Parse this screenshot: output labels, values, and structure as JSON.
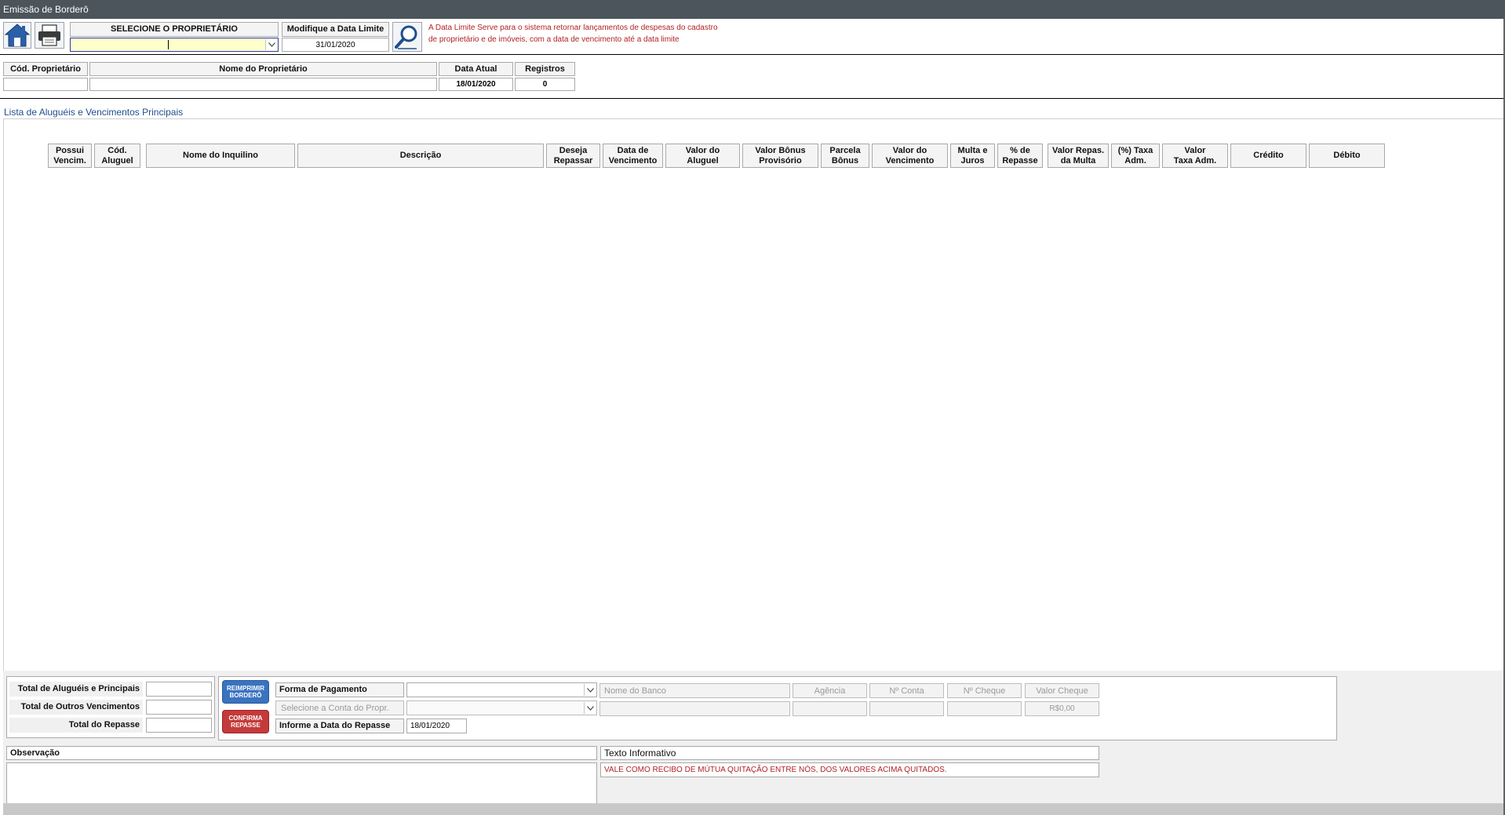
{
  "window": {
    "title": "Emissão de Borderô"
  },
  "toolbar": {
    "owner_header": "SELECIONE O PROPRIETÁRIO",
    "owner_value": "",
    "date_limit_header": "Modifique a Data Limite",
    "date_limit_value": "31/01/2020",
    "info_line1": "A Data Limite Serve para o sistema retornar lançamentos de despesas do cadastro",
    "info_line2": "de proprietário e de imóveis, com a data de vencimento até a data limite"
  },
  "owner_info": {
    "headers": [
      "Cód. Proprietário",
      "Nome do Proprietário",
      "Data Atual",
      "Registros"
    ],
    "values": [
      "",
      "",
      "18/01/2020",
      "0"
    ]
  },
  "list": {
    "title": "Lista de Aluguéis e Vencimentos Principais",
    "columns": [
      [
        "Possui",
        "Vencim."
      ],
      [
        "Cód.",
        "Aluguel"
      ],
      [
        "Nome do Inquilino"
      ],
      [
        "Descrição"
      ],
      [
        "Deseja",
        "Repassar"
      ],
      [
        "Data de",
        "Vencimento"
      ],
      [
        "Valor do",
        "Aluguel"
      ],
      [
        "Valor Bônus",
        "Provisório"
      ],
      [
        "Parcela",
        "Bônus"
      ],
      [
        "Valor do",
        "Vencimento"
      ],
      [
        "Multa e",
        "Juros"
      ],
      [
        "% de",
        "Repasse"
      ],
      [
        "Valor Repas.",
        "da Multa"
      ],
      [
        "(%) Taxa",
        "Adm."
      ],
      [
        "Valor",
        "Taxa Adm."
      ],
      [
        "Crédito"
      ],
      [
        "Débito"
      ]
    ]
  },
  "totals": {
    "rent_label": "Total de Aluguéis e Principais",
    "rent_value": "",
    "other_label": "Total de Outros Vencimentos",
    "other_value": "",
    "transfer_label": "Total do Repasse",
    "transfer_value": ""
  },
  "buttons": {
    "reprint": "REIMPRIMIR BORDERÔ",
    "confirm": "CONFIRMA REPASSE"
  },
  "payment": {
    "method_label": "Forma de Pagamento",
    "method_value": "",
    "account_label": "Selecione a Conta do Propr.",
    "account_value": "",
    "date_label": "Informe a Data do Repasse",
    "date_value": "18/01/2020",
    "bank_label": "Nome do Banco",
    "agency_label": "Agência",
    "account_no_label": "Nº Conta",
    "check_no_label": "Nº Cheque",
    "check_value_label": "Valor Cheque",
    "bank_value": "",
    "agency_value": "",
    "account_no_value": "",
    "check_no_value": "",
    "check_value": "R$0,00"
  },
  "notes": {
    "observation_label": "Observação",
    "observation_value": "",
    "info_label": "Texto Informativo",
    "info_value": "VALE COMO RECIBO DE MÚTUA QUITAÇÃO ENTRE NÓS, DOS VALORES ACIMA QUITADOS."
  },
  "colors": {
    "titlebar": "#4b555b",
    "accent_red": "#b22222",
    "section_blue": "#1f4e8c",
    "input_yellow": "#ffffcc",
    "button_blue": "#3a73c0",
    "button_red": "#c53a3a"
  }
}
